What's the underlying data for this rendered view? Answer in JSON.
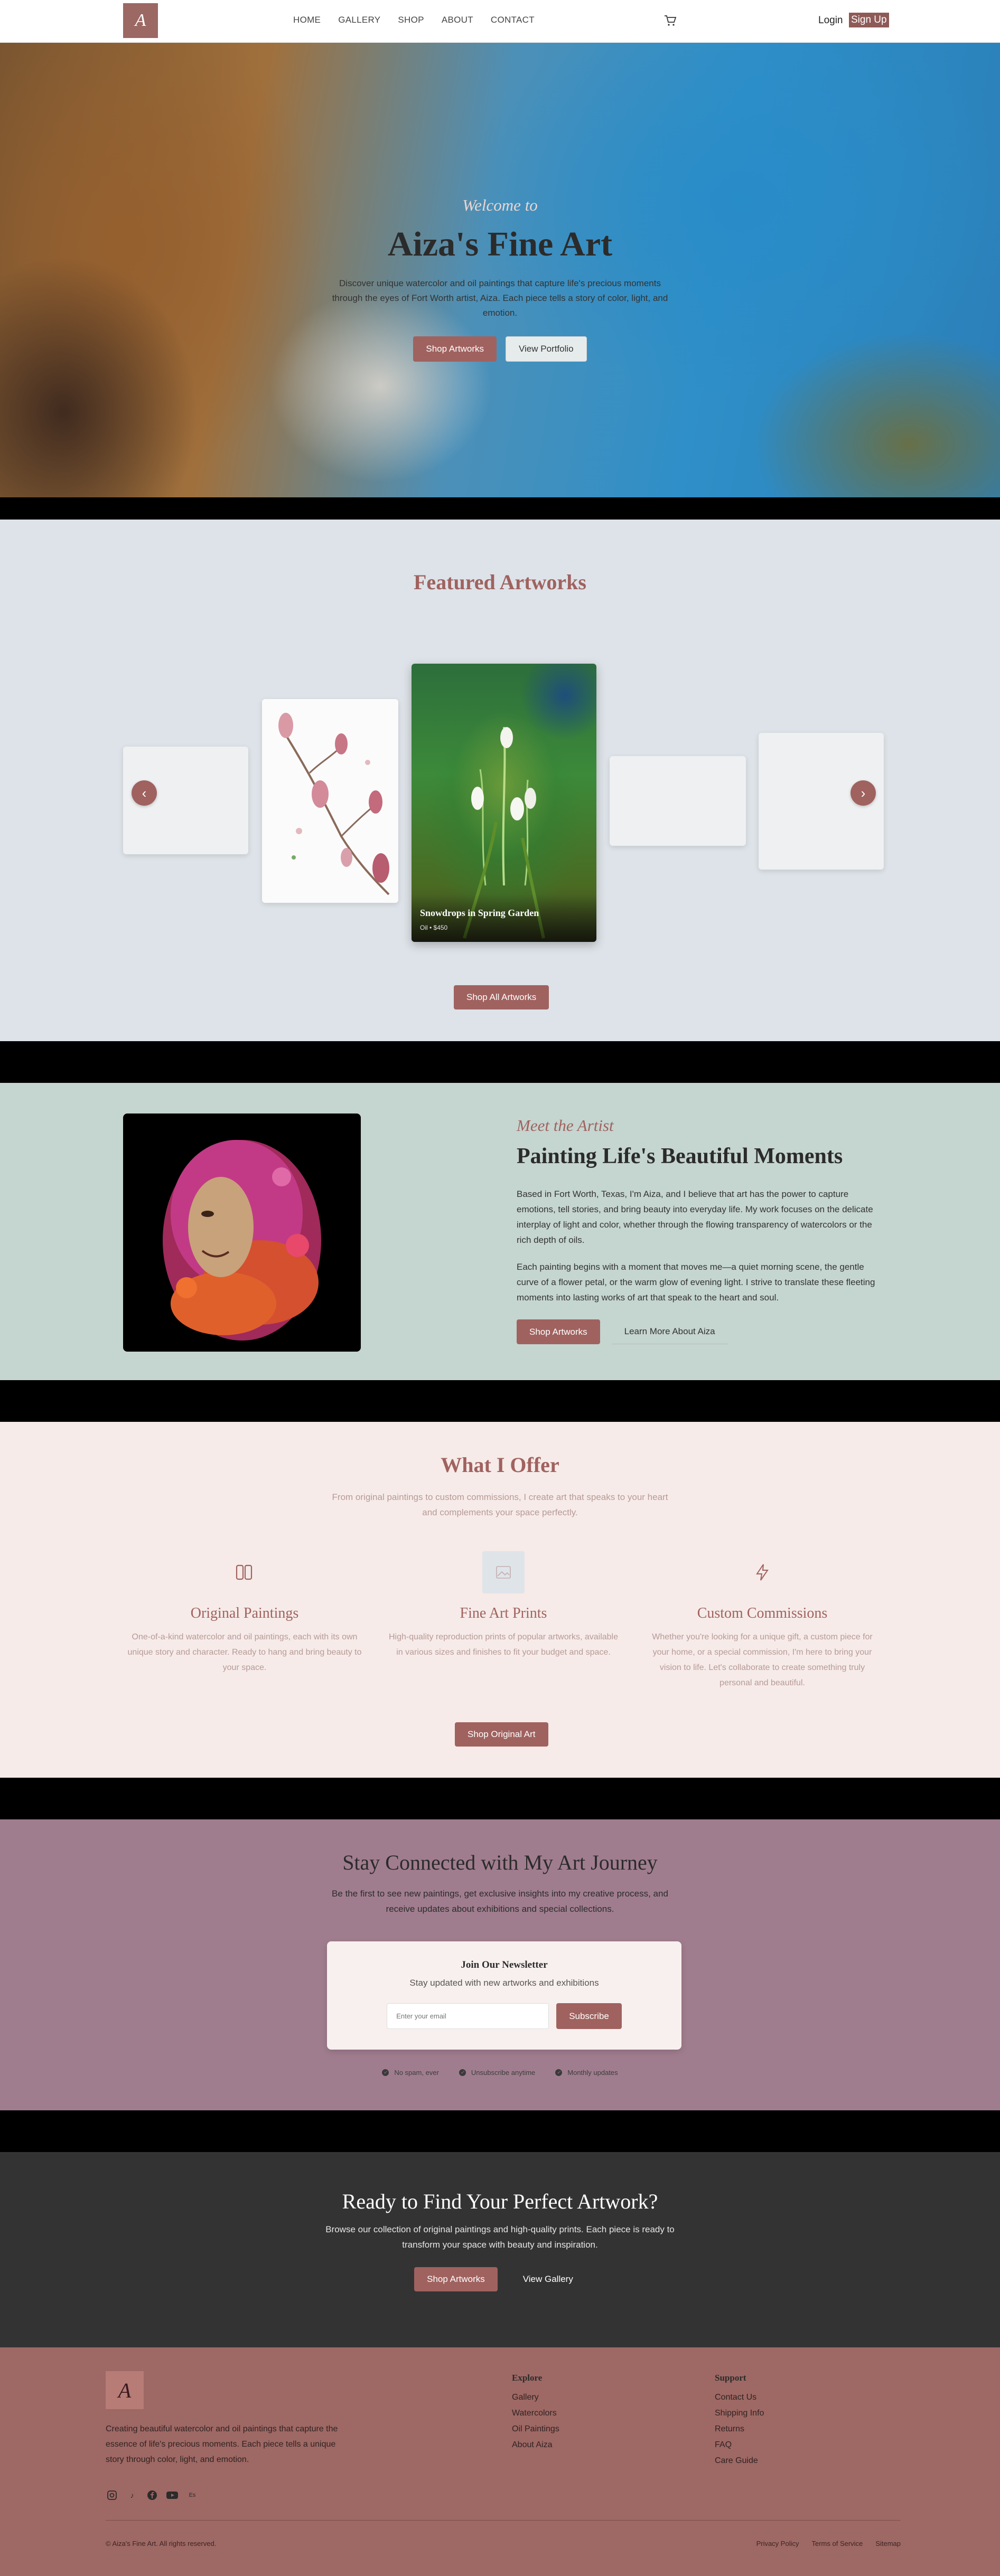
{
  "nav": {
    "links": [
      "HOME",
      "GALLERY",
      "SHOP",
      "ABOUT",
      "CONTACT"
    ],
    "login": "Login",
    "signup": "Sign Up"
  },
  "hero": {
    "kicker": "Welcome to",
    "title": "Aiza's Fine Art",
    "text": "Discover unique watercolor and oil paintings that capture life's precious moments through the eyes of Fort Worth artist, Aiza. Each piece tells a story of color, light, and emotion.",
    "btn_shop": "Shop Artworks",
    "btn_portfolio": "View Portfolio"
  },
  "featured": {
    "title": "Featured Artworks",
    "active_title": "Snowdrops in Spring Garden",
    "active_sub": "Oil • $450",
    "btn_all": "Shop All Artworks"
  },
  "artist": {
    "kicker": "Meet the Artist",
    "title": "Painting Life's Beautiful Moments",
    "p1": "Based in Fort Worth, Texas, I'm Aiza, and I believe that art has the power to capture emotions, tell stories, and bring beauty into everyday life. My work focuses on the delicate interplay of light and color, whether through the flowing transparency of watercolors or the rich depth of oils.",
    "p2": "Each painting begins with a moment that moves me—a quiet morning scene, the gentle curve of a flower petal, or the warm glow of evening light. I strive to translate these fleeting moments into lasting works of art that speak to the heart and soul.",
    "btn_shop": "Shop Artworks",
    "btn_more": "Learn More About Aiza"
  },
  "offer": {
    "title": "What I Offer",
    "sub": "From original paintings to custom commissions, I create art that speaks to your heart and complements your space perfectly.",
    "items": [
      {
        "title": "Original Paintings",
        "text": "One-of-a-kind watercolor and oil paintings, each with its own unique story and character. Ready to hang and bring beauty to your space."
      },
      {
        "title": "Fine Art Prints",
        "text": "High-quality reproduction prints of popular artworks, available in various sizes and finishes to fit your budget and space."
      },
      {
        "title": "Custom Commissions",
        "text": "Whether you're looking for a unique gift, a custom piece for your home, or a special commission, I'm here to bring your vision to life. Let's collaborate to create something truly personal and beautiful."
      }
    ],
    "btn": "Shop Original Art"
  },
  "newsletter": {
    "title": "Stay Connected with My Art Journey",
    "sub": "Be the first to see new paintings, get exclusive insights into my creative process, and receive updates about exhibitions and special collections.",
    "card_title": "Join Our Newsletter",
    "card_sub": "Stay updated with new artworks and exhibitions",
    "placeholder": "Enter your email",
    "btn": "Subscribe",
    "perks": [
      "No spam, ever",
      "Unsubscribe anytime",
      "Monthly updates"
    ]
  },
  "cta": {
    "title": "Ready to Find Your Perfect Artwork?",
    "text": "Browse our collection of original paintings and high-quality prints. Each piece is ready to transform your space with beauty and inspiration.",
    "btn_shop": "Shop Artworks",
    "btn_gallery": "View Gallery"
  },
  "footer": {
    "desc": "Creating beautiful watercolor and oil paintings that capture the essence of life's precious moments. Each piece tells a unique story through color, light, and emotion.",
    "explore_title": "Explore",
    "explore": [
      "Gallery",
      "Watercolors",
      "Oil Paintings",
      "About Aiza"
    ],
    "support_title": "Support",
    "support": [
      "Contact Us",
      "Shipping Info",
      "Returns",
      "FAQ",
      "Care Guide"
    ],
    "copyright": "© Aiza's Fine Art. All rights reserved.",
    "legal": [
      "Privacy Policy",
      "Terms of Service",
      "Sitemap"
    ]
  }
}
